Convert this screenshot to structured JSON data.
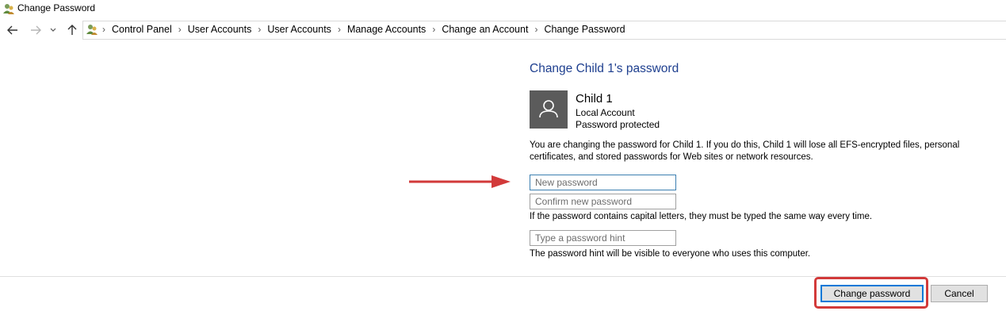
{
  "window": {
    "title": "Change Password"
  },
  "nav": {
    "back_icon": "arrow-left-icon",
    "forward_icon": "arrow-right-icon",
    "recent_icon": "chevron-down-icon",
    "up_icon": "arrow-up-icon"
  },
  "breadcrumb": {
    "items": [
      "Control Panel",
      "User Accounts",
      "User Accounts",
      "Manage Accounts",
      "Change an Account",
      "Change Password"
    ]
  },
  "main": {
    "heading": "Change Child 1's password",
    "user": {
      "name": "Child 1",
      "account_type": "Local Account",
      "status": "Password protected"
    },
    "warning": "You are changing the password for Child 1.  If you do this, Child 1 will lose all EFS-encrypted files, personal certificates, and stored passwords for Web sites or network resources.",
    "new_password": {
      "value": "",
      "placeholder": "New password"
    },
    "confirm_password": {
      "value": "",
      "placeholder": "Confirm new password"
    },
    "capital_note": "If the password contains capital letters, they must be typed the same way every time.",
    "hint": {
      "value": "",
      "placeholder": "Type a password hint"
    },
    "hint_note": "The password hint will be visible to everyone who uses this computer."
  },
  "footer": {
    "change_label": "Change password",
    "cancel_label": "Cancel"
  },
  "colors": {
    "heading": "#1e3f8f",
    "annotation_red": "#d23a3a",
    "focus_blue": "#0078d7"
  }
}
